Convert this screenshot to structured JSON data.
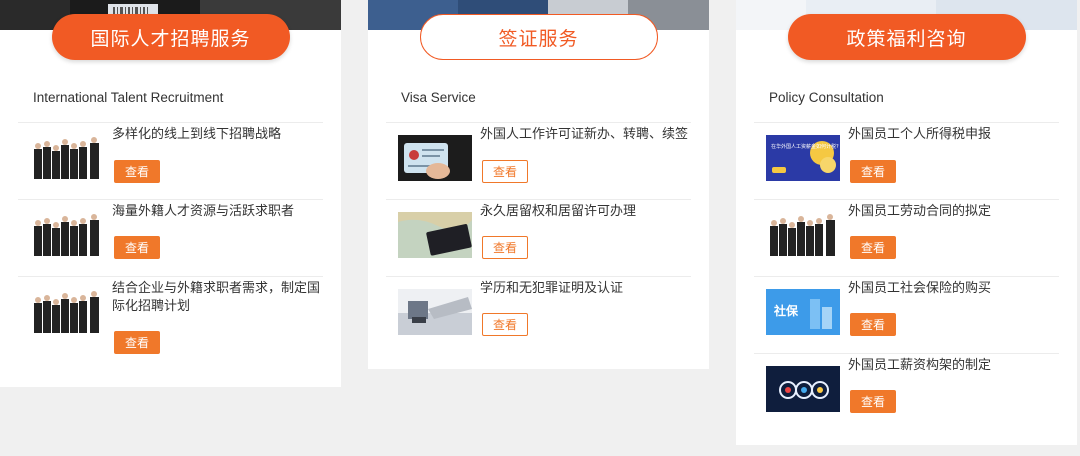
{
  "cards": [
    {
      "title": "国际人才招聘服务",
      "subtitle": "International Talent Recruitment",
      "items": [
        {
          "title": "多样化的线上到线下招聘战略",
          "button": "查看"
        },
        {
          "title": "海量外籍人才资源与活跃求职者",
          "button": "查看"
        },
        {
          "title": "结合企业与外籍求职者需求，制定国际化招聘计划",
          "button": "查看"
        }
      ]
    },
    {
      "title": "签证服务",
      "subtitle": "Visa Service",
      "items": [
        {
          "title": "外国人工作许可证新办、转聘、续签",
          "button": "查看"
        },
        {
          "title": "永久居留权和居留许可办理",
          "button": "查看"
        },
        {
          "title": "学历和无犯罪证明及认证",
          "button": "查看"
        }
      ]
    },
    {
      "title": "政策福利咨询",
      "subtitle": "Policy Consultation",
      "items": [
        {
          "title": "外国员工个人所得税申报",
          "button": "查看",
          "thumb_text": "在华外国人工资薪金如何计税?"
        },
        {
          "title": "外国员工劳动合同的拟定",
          "button": "查看"
        },
        {
          "title": "外国员工社会保险的购买",
          "button": "查看",
          "thumb_text": "社保"
        },
        {
          "title": "外国员工薪资构架的制定",
          "button": "查看"
        }
      ]
    }
  ],
  "colors": {
    "accent": "#f15a24",
    "button": "#f0782a"
  }
}
